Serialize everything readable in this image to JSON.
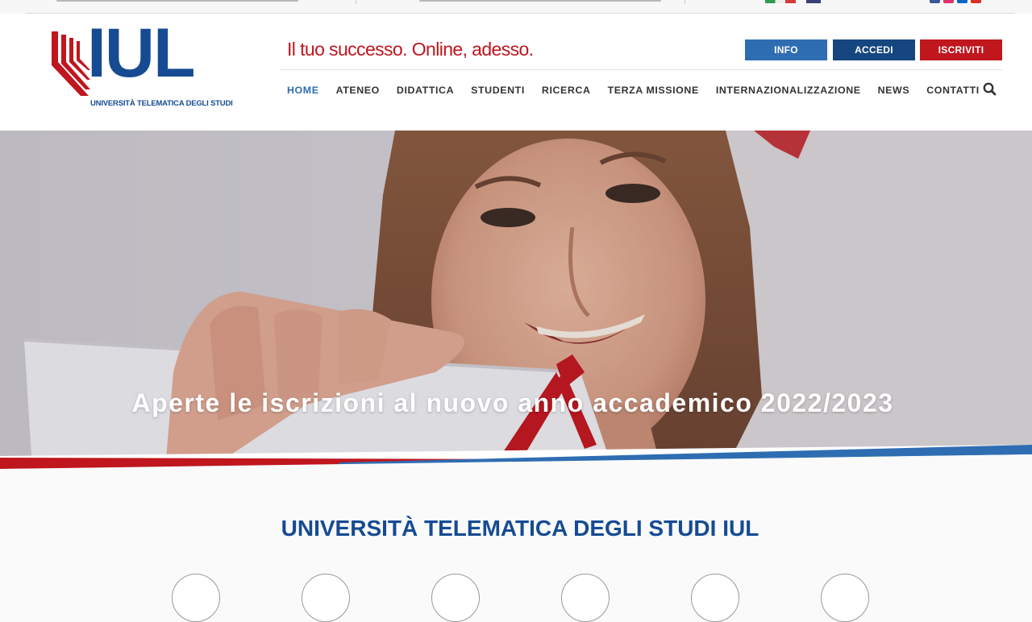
{
  "header": {
    "logo_text": "IUL",
    "logo_subtitle": "UNIVERSITÀ TELEMATICA DEGLI STUDI",
    "slogan": "Il tuo successo. Online, adesso."
  },
  "buttons": {
    "info": "INFO",
    "accedi": "ACCEDI",
    "iscriviti": "ISCRIVITI"
  },
  "nav": {
    "items": [
      "HOME",
      "ATENEO",
      "DIDATTICA",
      "STUDENTI",
      "RICERCA",
      "TERZA MISSIONE",
      "INTERNAZIONALIZZAZIONE",
      "NEWS",
      "CONTATTI"
    ],
    "active": "HOME"
  },
  "hero": {
    "caption": "Aperte le iscrizioni al nuovo anno accademico 2022/2023"
  },
  "section": {
    "title": "UNIVERSITÀ TELEMATICA DEGLI STUDI IUL"
  },
  "icons": {
    "search": "search-icon",
    "social": [
      "facebook-icon",
      "instagram-icon",
      "linkedin-icon",
      "youtube-icon"
    ],
    "flags": [
      "italian-flag-icon",
      "english-flag-icon"
    ]
  },
  "colors": {
    "brand_blue": "#164b93",
    "brand_red": "#c0161e",
    "info_blue": "#2f6db2",
    "accedi_blue": "#16467f"
  }
}
